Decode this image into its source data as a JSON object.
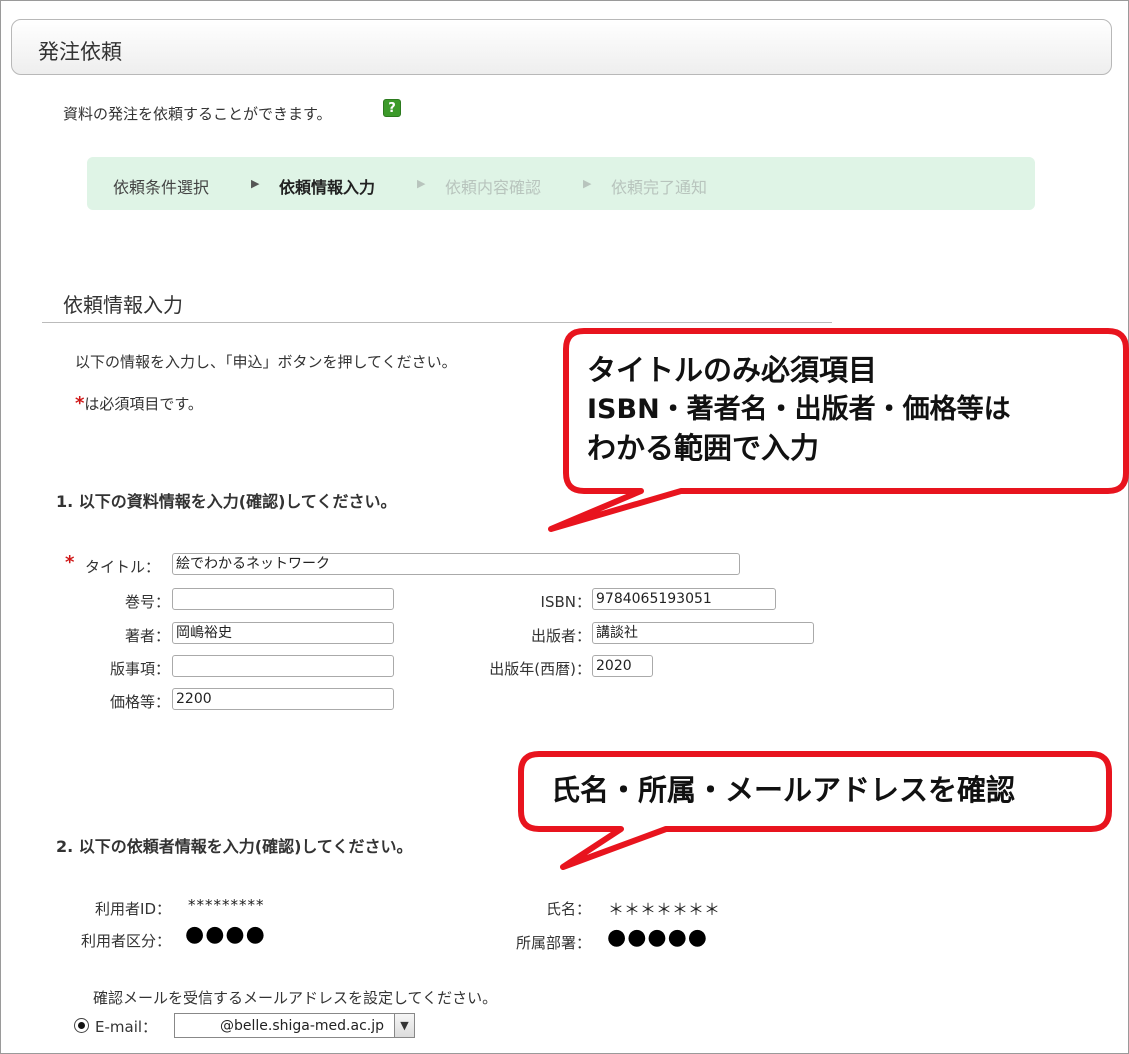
{
  "header": {
    "title": "発注依頼"
  },
  "intro": {
    "text": "資料の発注を依頼することができます。",
    "help_icon": "?"
  },
  "steps": [
    {
      "label": "依頼条件選択",
      "state": "done"
    },
    {
      "label": "依頼情報入力",
      "state": "active"
    },
    {
      "label": "依頼内容確認",
      "state": "future"
    },
    {
      "label": "依頼完了通知",
      "state": "future"
    }
  ],
  "step_arrow": "▶",
  "section": {
    "title": "依頼情報入力",
    "instruction": "以下の情報を入力し、「申込」ボタンを押してください。",
    "required_mark": "*",
    "required_note": "は必須項目です。"
  },
  "part1": {
    "heading": "1. 以下の資料情報を入力(確認)してください。",
    "fields": {
      "title": {
        "label": "タイトル：",
        "value": "絵でわかるネットワーク"
      },
      "volume": {
        "label": "巻号：",
        "value": ""
      },
      "isbn": {
        "label": "ISBN：",
        "value": "9784065193051"
      },
      "author": {
        "label": "著者：",
        "value": "岡嶋裕史"
      },
      "publisher": {
        "label": "出版者：",
        "value": "講談社"
      },
      "edition": {
        "label": "版事項：",
        "value": ""
      },
      "pub_year": {
        "label": "出版年(西暦)：",
        "value": "2020"
      },
      "price": {
        "label": "価格等：",
        "value": "2200"
      }
    }
  },
  "part2": {
    "heading": "2. 以下の依頼者情報を入力(確認)してください。",
    "user_id": {
      "label": "利用者ID：",
      "value": "*********"
    },
    "name": {
      "label": "氏名：",
      "value": "＊＊＊＊＊＊＊"
    },
    "user_type": {
      "label": "利用者区分：",
      "value": "●●●●"
    },
    "department": {
      "label": "所属部署：",
      "value": "●●●●●"
    },
    "email_note": "確認メールを受信するメールアドレスを設定してください。",
    "email_label": "E-mail：",
    "email_value": "@belle.shiga-med.ac.jp",
    "select_arrow": "▼"
  },
  "callouts": {
    "top": {
      "line1": "タイトルのみ必須項目",
      "line2": "ISBN・著者名・出版者・価格等は",
      "line3": "わかる範囲で入力"
    },
    "bottom": {
      "text": "氏名・所属・メールアドレスを確認"
    }
  },
  "colors": {
    "callout_border": "#e8141e",
    "steps_bg": "#dff4e6",
    "required": "#d01818"
  }
}
